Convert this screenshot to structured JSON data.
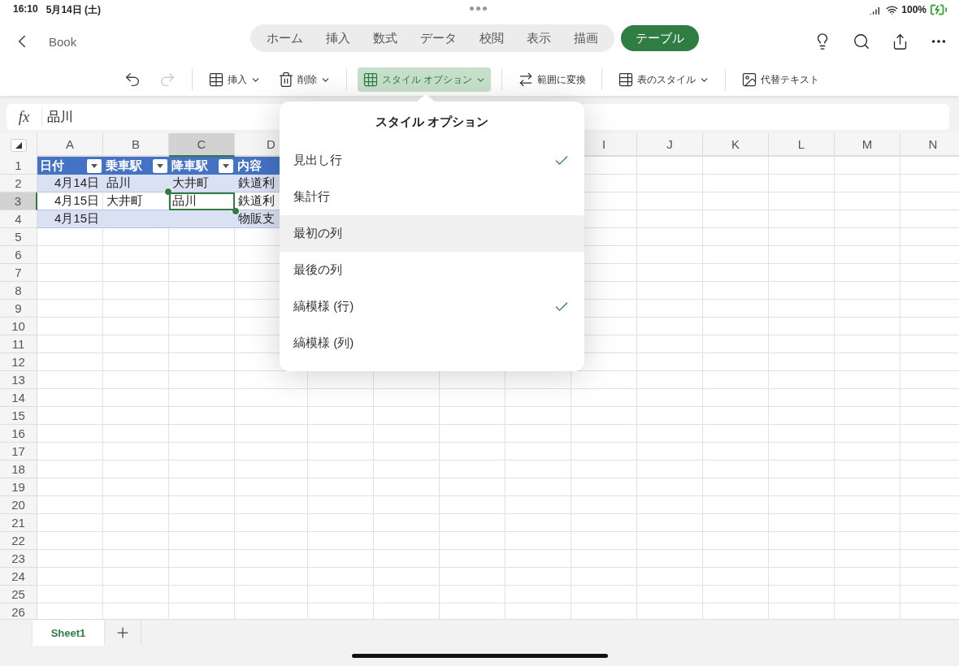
{
  "status_bar": {
    "time": "16:10",
    "date": "5月14日 (土)",
    "battery": "100%"
  },
  "nav": {
    "back_label": "Book",
    "tabs": [
      {
        "label": "ホーム",
        "kind": "main",
        "selected": false
      },
      {
        "label": "挿入",
        "kind": "main",
        "selected": false
      },
      {
        "label": "数式",
        "kind": "main",
        "selected": false
      },
      {
        "label": "データ",
        "kind": "main",
        "selected": false
      },
      {
        "label": "校閲",
        "kind": "main",
        "selected": false
      },
      {
        "label": "表示",
        "kind": "main",
        "selected": false
      },
      {
        "label": "描画",
        "kind": "main",
        "selected": false
      },
      {
        "label": "テーブル",
        "kind": "contextual",
        "selected": true
      }
    ]
  },
  "toolbar": [
    {
      "kind": "icon",
      "disabled": false
    },
    {
      "kind": "icon",
      "disabled": true
    },
    {
      "kind": "separator"
    },
    {
      "kind": "button",
      "label": "挿入",
      "dropdown": true,
      "selected": false
    },
    {
      "kind": "button",
      "label": "削除",
      "dropdown": true,
      "selected": false
    },
    {
      "kind": "separator"
    },
    {
      "kind": "button",
      "label": "スタイル オプション",
      "dropdown": true,
      "selected": true
    },
    {
      "kind": "separator"
    },
    {
      "kind": "button",
      "label": "範囲に変換",
      "dropdown": false,
      "selected": false
    },
    {
      "kind": "separator"
    },
    {
      "kind": "button",
      "label": "表のスタイル",
      "dropdown": true,
      "selected": false
    },
    {
      "kind": "separator"
    },
    {
      "kind": "button",
      "label": "代替テキスト",
      "dropdown": false,
      "selected": false
    }
  ],
  "formula_bar": {
    "label": "fx",
    "value": "品川"
  },
  "sheet": {
    "columns_left": [
      {
        "label": "A",
        "selected": false
      },
      {
        "label": "B",
        "selected": false
      },
      {
        "label": "C",
        "selected": true
      },
      {
        "label": "D",
        "selected": false
      }
    ],
    "columns_right": [
      {
        "label": "I",
        "selected": false
      },
      {
        "label": "J",
        "selected": false
      },
      {
        "label": "K",
        "selected": false
      },
      {
        "label": "L",
        "selected": false
      },
      {
        "label": "M",
        "selected": false
      },
      {
        "label": "N",
        "selected": false
      }
    ],
    "rows": [
      {
        "label": "1",
        "selected": false
      },
      {
        "label": "2",
        "selected": false
      },
      {
        "label": "3",
        "selected": true
      },
      {
        "label": "4",
        "selected": false
      },
      {
        "label": "5",
        "selected": false
      },
      {
        "label": "6",
        "selected": false
      },
      {
        "label": "7",
        "selected": false
      },
      {
        "label": "8",
        "selected": false
      },
      {
        "label": "9",
        "selected": false
      },
      {
        "label": "10",
        "selected": false
      },
      {
        "label": "11",
        "selected": false
      },
      {
        "label": "12",
        "selected": false
      },
      {
        "label": "13",
        "selected": false
      },
      {
        "label": "14",
        "selected": false
      },
      {
        "label": "15",
        "selected": false
      },
      {
        "label": "16",
        "selected": false
      },
      {
        "label": "17",
        "selected": false
      },
      {
        "label": "18",
        "selected": false
      },
      {
        "label": "19",
        "selected": false
      },
      {
        "label": "20",
        "selected": false
      },
      {
        "label": "21",
        "selected": false
      },
      {
        "label": "22",
        "selected": false
      },
      {
        "label": "23",
        "selected": false
      },
      {
        "label": "24",
        "selected": false
      },
      {
        "label": "25",
        "selected": false
      },
      {
        "label": "26",
        "selected": false
      }
    ],
    "table": {
      "header": [
        {
          "label": "日付",
          "filter": true
        },
        {
          "label": "乗車駅",
          "filter": true
        },
        {
          "label": "降車駅",
          "filter": true
        },
        {
          "label": "内容"
        }
      ],
      "rows": [
        {
          "banded": true,
          "cells": [
            {
              "text": "4月14日",
              "selected": false
            },
            {
              "text": "品川",
              "selected": false
            },
            {
              "text": "大井町",
              "selected": false
            },
            {
              "text": "鉄道利",
              "selected": false
            }
          ]
        },
        {
          "banded": false,
          "cells": [
            {
              "text": "4月15日",
              "selected": false
            },
            {
              "text": "大井町",
              "selected": false
            },
            {
              "text": "品川",
              "selected": true
            },
            {
              "text": "鉄道利",
              "selected": false
            }
          ]
        },
        {
          "banded": true,
          "cells": [
            {
              "text": "4月15日",
              "selected": false
            },
            {
              "selected": false
            },
            {
              "selected": false
            },
            {
              "text": "物販支",
              "selected": false
            }
          ]
        }
      ]
    }
  },
  "popover": {
    "title": "スタイル オプション",
    "items": [
      {
        "label": "見出し行",
        "checked": true,
        "highlighted": false
      },
      {
        "label": "集計行",
        "checked": false,
        "highlighted": false
      },
      {
        "label": "最初の列",
        "checked": false,
        "highlighted": true
      },
      {
        "label": "最後の列",
        "checked": false,
        "highlighted": false
      },
      {
        "label": "縞模様 (行)",
        "checked": true,
        "highlighted": false
      },
      {
        "label": "縞模様 (列)",
        "checked": false,
        "highlighted": false
      }
    ]
  },
  "sheet_tabs": [
    {
      "label": "Sheet1",
      "selected": true
    }
  ]
}
